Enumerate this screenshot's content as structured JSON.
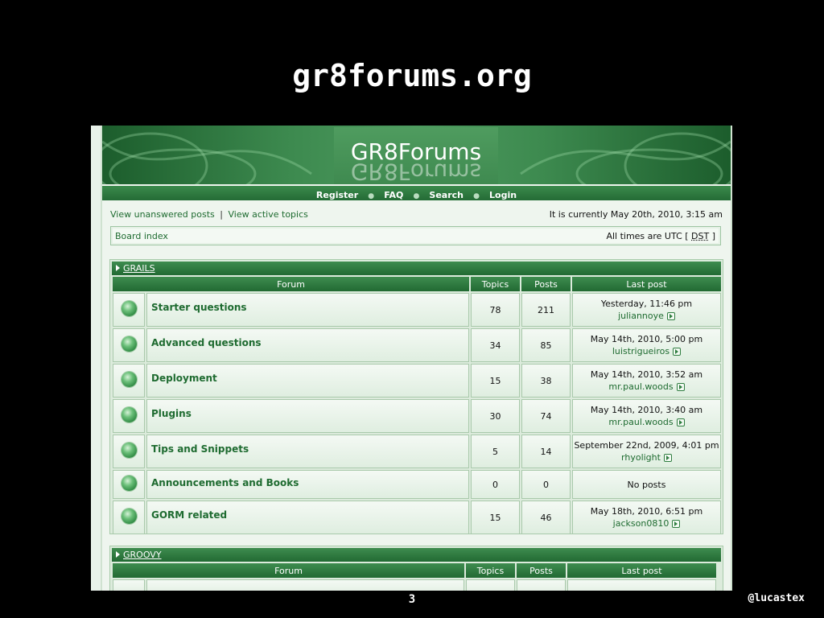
{
  "slide": {
    "title": "gr8forums.org",
    "page": "3",
    "handle": "@lucastex"
  },
  "site": {
    "logo": "GR8Forums"
  },
  "nav": {
    "items": [
      "Register",
      "FAQ",
      "Search",
      "Login"
    ]
  },
  "toplinks": {
    "unanswered": "View unanswered posts",
    "separator": "|",
    "active": "View active topics"
  },
  "datetime": "It is currently May 20th, 2010, 3:15 am",
  "breadcrumb": {
    "board_index": "Board index",
    "timezone_prefix": "All times are UTC [",
    "dst": "DST",
    "timezone_suffix": "]"
  },
  "columns": {
    "forum": "Forum",
    "topics": "Topics",
    "posts": "Posts",
    "last_post": "Last post"
  },
  "categories": [
    {
      "name": "GRAILS",
      "forums": [
        {
          "name": "Starter questions",
          "topics": "78",
          "posts": "211",
          "last_date": "Yesterday, 11:46 pm",
          "last_user": "juliannoye"
        },
        {
          "name": "Advanced questions",
          "topics": "34",
          "posts": "85",
          "last_date": "May 14th, 2010, 5:00 pm",
          "last_user": "luistrigueiros"
        },
        {
          "name": "Deployment",
          "topics": "15",
          "posts": "38",
          "last_date": "May 14th, 2010, 3:52 am",
          "last_user": "mr.paul.woods"
        },
        {
          "name": "Plugins",
          "topics": "30",
          "posts": "74",
          "last_date": "May 14th, 2010, 3:40 am",
          "last_user": "mr.paul.woods"
        },
        {
          "name": "Tips and Snippets",
          "topics": "5",
          "posts": "14",
          "last_date": "September 22nd, 2009, 4:01 pm",
          "last_user": "rhyolight"
        },
        {
          "name": "Announcements and Books",
          "topics": "0",
          "posts": "0",
          "last_date": "No posts",
          "last_user": ""
        },
        {
          "name": "GORM related",
          "topics": "15",
          "posts": "46",
          "last_date": "May 18th, 2010, 6:51 pm",
          "last_user": "jackson0810"
        }
      ]
    },
    {
      "name": "GROOVY",
      "forums": []
    }
  ],
  "colors": {
    "accent": "#226a33",
    "link": "#1e6b30",
    "background": "#eef5ee"
  }
}
